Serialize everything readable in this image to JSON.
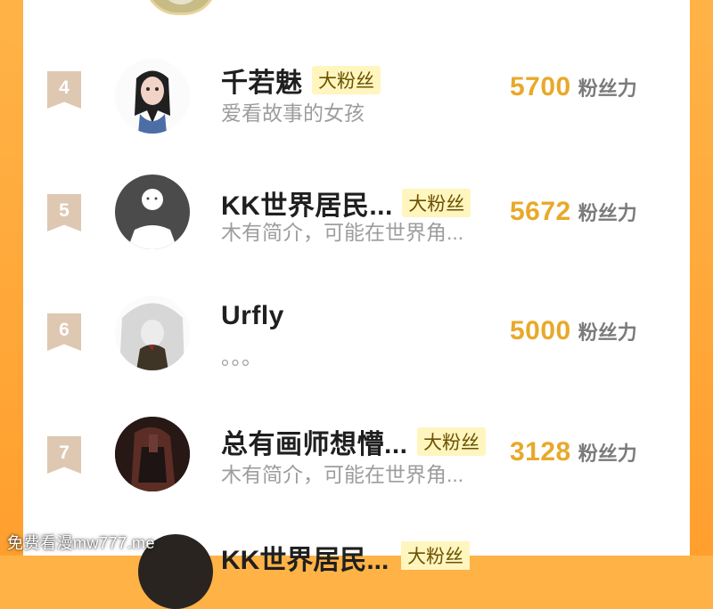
{
  "leaderboard": {
    "unit": "粉丝力",
    "entries": [
      {
        "rank": "4",
        "name": "千若魅",
        "badge": "大粉丝",
        "desc": "爱看故事的女孩",
        "fans": "5700"
      },
      {
        "rank": "5",
        "name": "KK世界居民...",
        "badge": "大粉丝",
        "desc": "木有简介，可能在世界角...",
        "fans": "5672"
      },
      {
        "rank": "6",
        "name": "Urfly",
        "badge": "",
        "desc": "。。。",
        "fans": "5000"
      },
      {
        "rank": "7",
        "name": "总有画师想懵...",
        "badge": "大粉丝",
        "desc": "木有简介，可能在世界角...",
        "fans": "3128"
      }
    ],
    "partial": {
      "name": "KK世界居民...",
      "badge": "大粉丝"
    }
  },
  "watermark": "免费看漫mw777.me"
}
